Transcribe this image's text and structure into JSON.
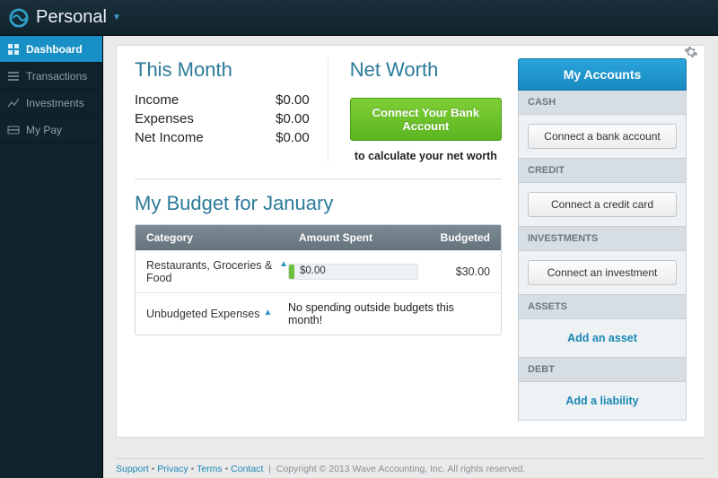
{
  "header": {
    "brand": "Personal"
  },
  "sidebar": {
    "items": [
      {
        "label": "Dashboard"
      },
      {
        "label": "Transactions"
      },
      {
        "label": "Investments"
      },
      {
        "label": "My Pay"
      }
    ]
  },
  "month": {
    "title": "This Month",
    "rows": [
      {
        "label": "Income",
        "value": "$0.00"
      },
      {
        "label": "Expenses",
        "value": "$0.00"
      },
      {
        "label": "Net Income",
        "value": "$0.00"
      }
    ]
  },
  "networth": {
    "title": "Net Worth",
    "button": "Connect Your Bank Account",
    "subtitle": "to calculate your net worth"
  },
  "budget": {
    "title": "My Budget for January",
    "headers": {
      "col1": "Category",
      "col2": "Amount Spent",
      "col3": "Budgeted"
    },
    "rows": [
      {
        "category": "Restaurants, Groceries & Food",
        "spent_label": "$0.00",
        "budgeted": "$30.00",
        "is_msg": false
      },
      {
        "category": "Unbudgeted Expenses",
        "message": "No spending outside budgets this month!",
        "is_msg": true
      }
    ]
  },
  "accounts": {
    "title": "My Accounts",
    "sections": [
      {
        "head": "CASH",
        "type": "button",
        "label": "Connect a bank account"
      },
      {
        "head": "CREDIT",
        "type": "button",
        "label": "Connect a credit card"
      },
      {
        "head": "INVESTMENTS",
        "type": "button",
        "label": "Connect an investment"
      },
      {
        "head": "ASSETS",
        "type": "link",
        "label": "Add an asset"
      },
      {
        "head": "DEBT",
        "type": "link",
        "label": "Add a liability"
      }
    ]
  },
  "footer": {
    "links": [
      "Support",
      "Privacy",
      "Terms",
      "Contact"
    ],
    "copyright": "Copyright © 2013 Wave Accounting, Inc. All rights reserved."
  }
}
